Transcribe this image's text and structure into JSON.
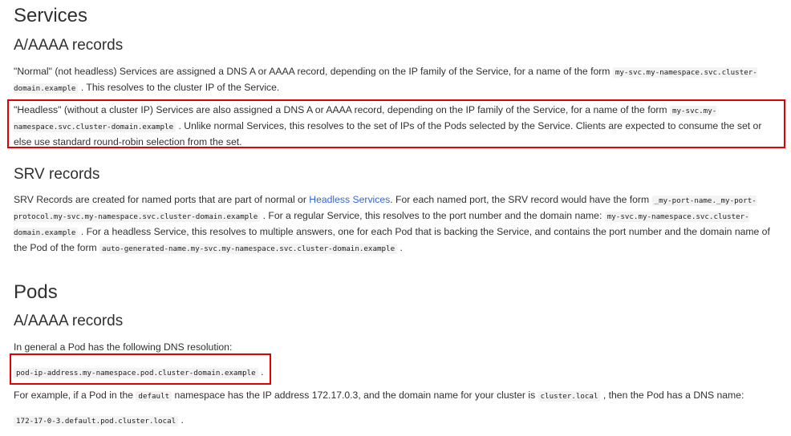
{
  "services": {
    "heading": "Services",
    "a_aaaa": {
      "heading": "A/AAAA records",
      "normal": {
        "t1": "\"Normal\" (not headless) Services are assigned a DNS A or AAAA record, depending on the IP family of the Service, for a name of the form ",
        "code": "my-svc.my-namespace.svc.cluster-domain.example",
        "t2": " . This resolves to the cluster IP of the Service."
      },
      "headless": {
        "t1": "\"Headless\" (without a cluster IP) Services are also assigned a DNS A or AAAA record, depending on the IP family of the Service, for a name of the form ",
        "code": "my-svc.my-namespace.svc.cluster-domain.example",
        "t2": " . Unlike normal Services, this resolves to the set of IPs of the Pods selected by the Service. Clients are expected to consume the set or else use standard round-robin selection from the set."
      }
    },
    "srv": {
      "heading": "SRV records",
      "t1": "SRV Records are created for named ports that are part of normal or ",
      "link": "Headless Services",
      "t2": ". For each named port, the SRV record would have the form ",
      "code1": "_my-port-name._my-port-protocol.my-svc.my-namespace.svc.cluster-domain.example",
      "t3": " . For a regular Service, this resolves to the port number and the domain name: ",
      "code2": "my-svc.my-namespace.svc.cluster-domain.example",
      "t4": " . For a headless Service, this resolves to multiple answers, one for each Pod that is backing the Service, and contains the port number and the domain name of the Pod of the form ",
      "code3": "auto-generated-name.my-svc.my-namespace.svc.cluster-domain.example",
      "t5": " ."
    }
  },
  "pods": {
    "heading": "Pods",
    "a_aaaa": {
      "heading": "A/AAAA records",
      "intro": "In general a Pod has the following DNS resolution:",
      "resolution_code": "pod-ip-address.my-namespace.pod.cluster-domain.example",
      "resolution_tail": " .",
      "example": {
        "t1": "For example, if a Pod in the ",
        "code1": "default",
        "t2": " namespace has the IP address 172.17.0.3, and the domain name for your cluster is ",
        "code2": "cluster.local",
        "t3": " , then the Pod has a DNS name:"
      },
      "example_code": "172-17-0-3.default.pod.cluster.local",
      "example_tail": " ."
    }
  },
  "colors": {
    "highlight_border": "#e00000",
    "link": "#3267d6",
    "code_bg": "#f3f3f3"
  }
}
